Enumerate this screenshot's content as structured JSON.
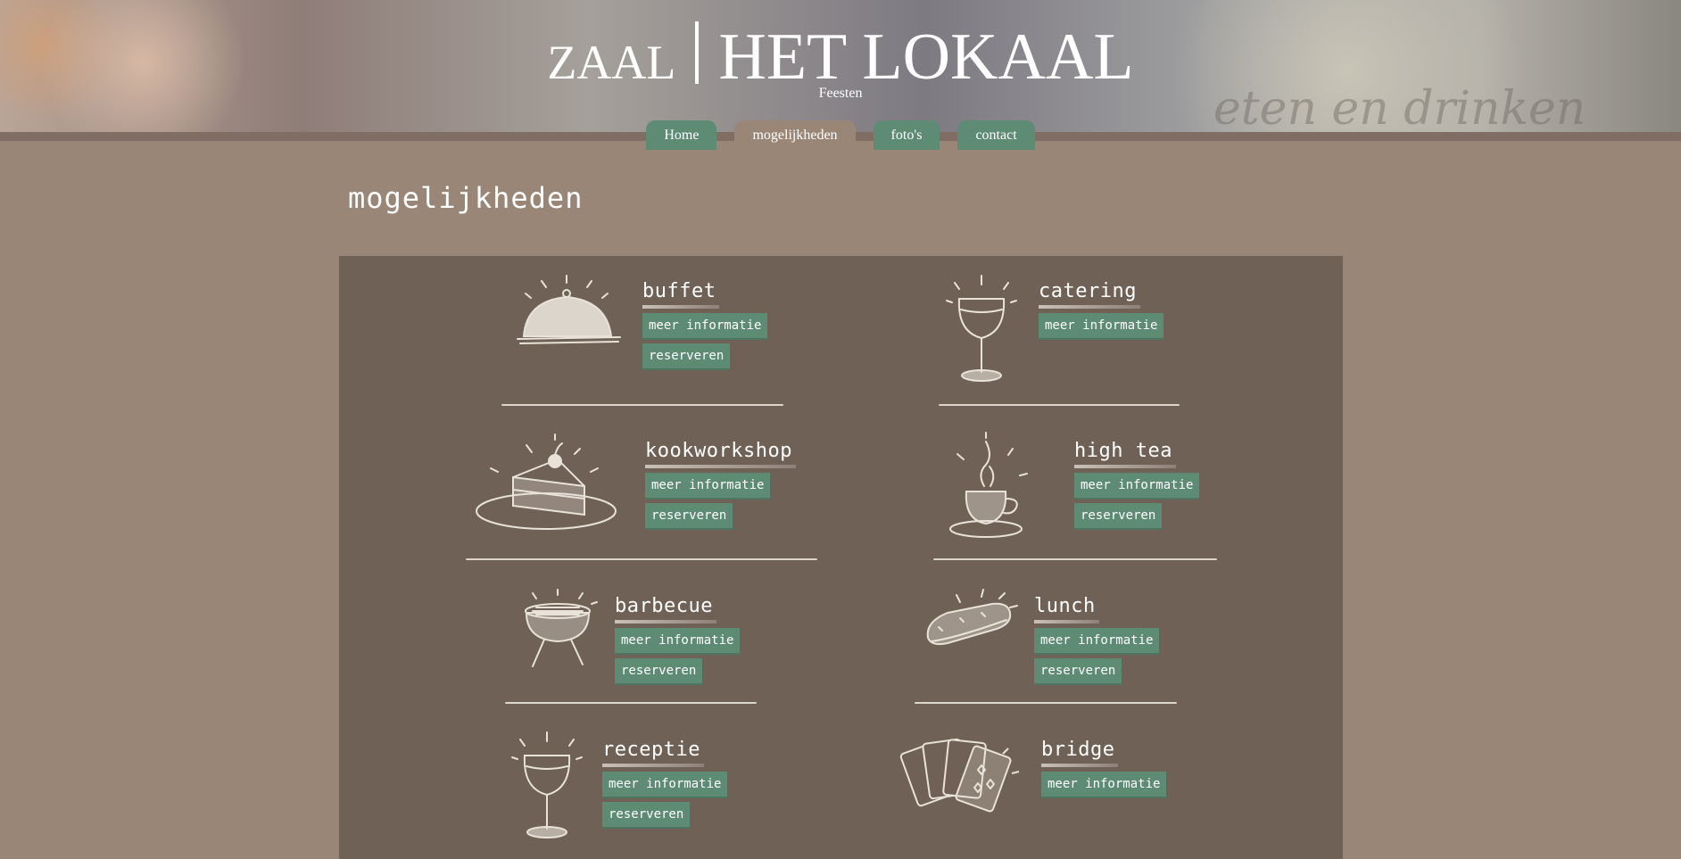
{
  "header": {
    "brand_left": "ZAAL",
    "brand_right": "HET LOKAAL",
    "subtitle": "Feesten",
    "background_lettering": "eten en drinken"
  },
  "nav": {
    "tabs": [
      {
        "label": "Home",
        "active": false
      },
      {
        "label": "mogelijkheden",
        "active": true
      },
      {
        "label": "foto's",
        "active": false
      },
      {
        "label": "contact",
        "active": false
      }
    ]
  },
  "page": {
    "title": "mogelijkheden"
  },
  "items": [
    {
      "name": "buffet",
      "icon": "food-cloche-icon",
      "info_label": "meer informatie",
      "reserve_label": "reserveren"
    },
    {
      "name": "catering",
      "icon": "wine-glass-icon",
      "info_label": "meer informatie"
    },
    {
      "name": "kookworkshop",
      "icon": "cake-slice-icon",
      "info_label": "meer informatie",
      "reserve_label": "reserveren"
    },
    {
      "name": "high tea",
      "icon": "teacup-icon",
      "info_label": "meer informatie",
      "reserve_label": "reserveren"
    },
    {
      "name": "barbecue",
      "icon": "barbecue-grill-icon",
      "info_label": "meer informatie",
      "reserve_label": "reserveren"
    },
    {
      "name": "lunch",
      "icon": "sandwich-icon",
      "info_label": "meer informatie",
      "reserve_label": "reserveren"
    },
    {
      "name": "receptie",
      "icon": "wine-glass-icon",
      "info_label": "meer informatie",
      "reserve_label": "reserveren"
    },
    {
      "name": "bridge",
      "icon": "playing-cards-icon",
      "info_label": "meer informatie"
    }
  ],
  "colors": {
    "page_background": "#9a8676",
    "panel_background": "#6f6156",
    "button_green": "#5d8b74",
    "text": "#ffffff"
  }
}
